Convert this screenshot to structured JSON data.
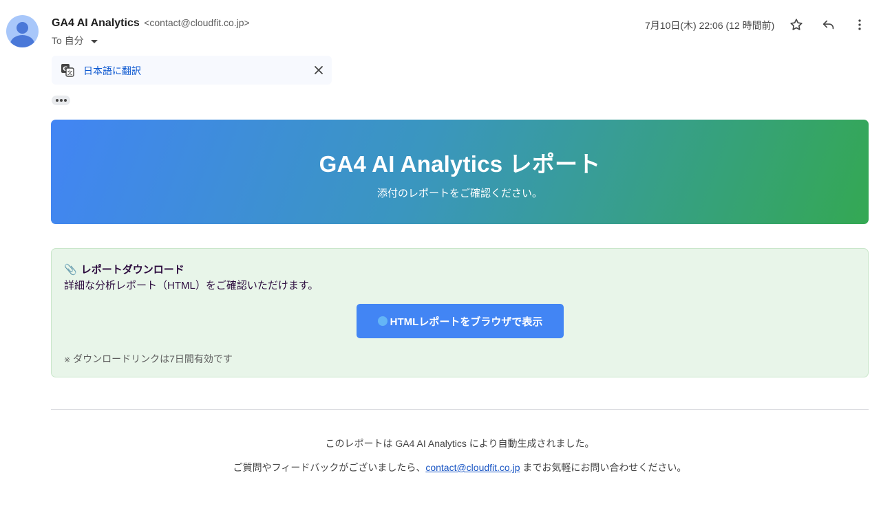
{
  "header": {
    "sender_name": "GA4 AI Analytics",
    "sender_email": "<contact@cloudfit.co.jp>",
    "to_label": "To 自分",
    "date": "7月10日(木) 22:06 (12 時間前)",
    "icons": [
      "star-icon",
      "reply-icon",
      "more-vert-icon"
    ]
  },
  "translate_bar": {
    "link_label": "日本語に翻訳",
    "icons": [
      "translate-icon",
      "close-icon"
    ]
  },
  "banner": {
    "title": "GA4 AI Analytics レポート",
    "subtitle": "添付のレポートをご確認ください。",
    "gradient": [
      "#4285f4",
      "#34a853"
    ]
  },
  "download": {
    "title_icon": "📎",
    "title": "レポートダウンロード",
    "description": "詳細な分析レポート（HTML）をご確認いただけます。",
    "button_label": "HTMLレポートをブラウザで表示",
    "note_mark": "※",
    "note": "ダウンロードリンクは7日間有効です",
    "button_color": "#4285f4",
    "background": "#e8f5e9"
  },
  "footer": {
    "line1": "このレポートは GA4 AI Analytics により自動生成されました。",
    "line2_before": "ご質問やフィードバックがございましたら、",
    "link_text": "contact@cloudfit.co.jp",
    "line2_after": " までお気軽にお問い合わせください。"
  }
}
